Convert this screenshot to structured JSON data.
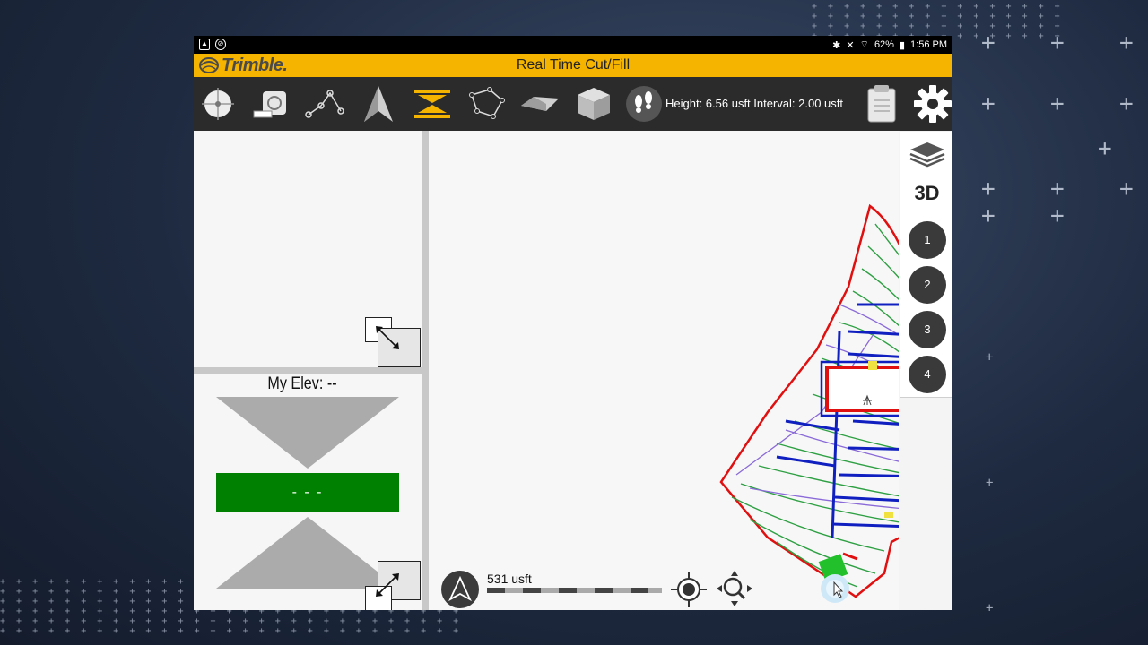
{
  "status_bar": {
    "battery": "62%",
    "time": "1:56 PM"
  },
  "app": {
    "brand": "Trimble.",
    "title": "Real Time Cut/Fill"
  },
  "toolbar": {
    "tools": [
      {
        "icon": "crosshair-target-icon"
      },
      {
        "icon": "measure-box-icon"
      },
      {
        "icon": "polyline-points-icon"
      },
      {
        "icon": "north-arrow-icon"
      },
      {
        "icon": "cut-fill-chevrons-icon"
      },
      {
        "icon": "polygon-points-icon"
      },
      {
        "icon": "surface-plane-icon"
      },
      {
        "icon": "cube-icon"
      },
      {
        "icon": "footsteps-icon"
      }
    ],
    "height_interval": "Height: 6.56 usft Interval: 2.00 usft",
    "clipboard_icon": "clipboard-icon",
    "settings_icon": "gear-icon"
  },
  "left_panel": {
    "my_elev": "My Elev: --",
    "cut_fill_value": "- - -",
    "cut_fill_color": "#008000"
  },
  "right_bar": {
    "layers_icon": "layers-icon",
    "label_3d": "3D",
    "views": [
      "1",
      "2",
      "3",
      "4"
    ]
  },
  "map": {
    "scale_label": "531 usft"
  },
  "colors": {
    "title_bar": "#f5b400",
    "toolbar": "#2b2b2b",
    "accent_green": "#008000"
  }
}
